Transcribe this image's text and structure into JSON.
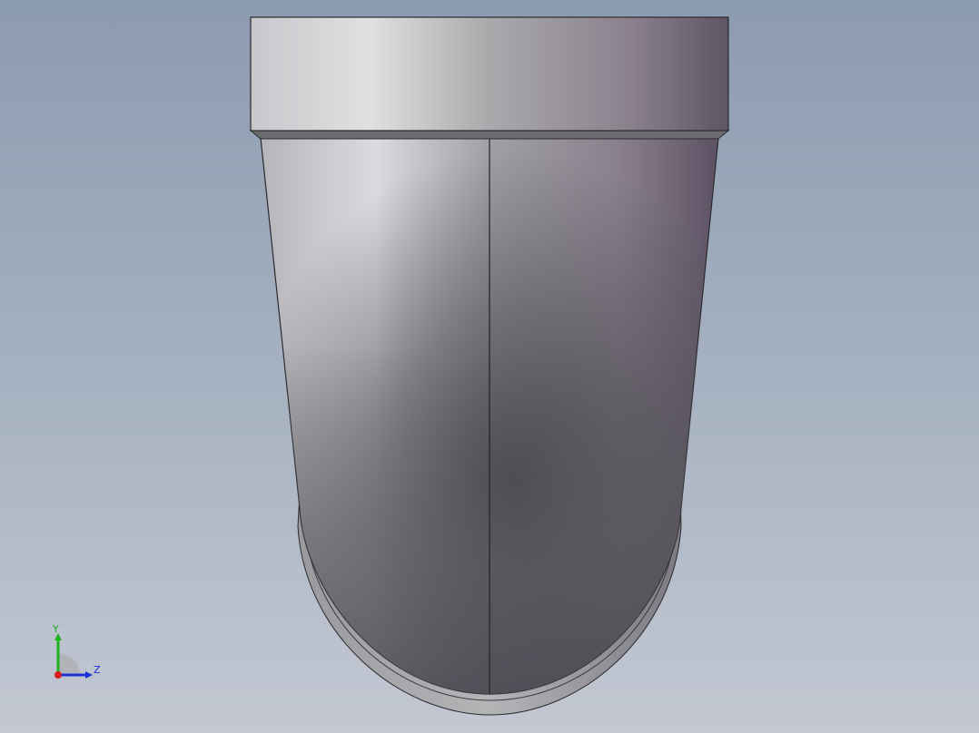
{
  "viewport": {
    "background_top": "#8c9bb0",
    "background_bottom": "#c3c8d2"
  },
  "model": {
    "name": "pipe-elbow",
    "colors": {
      "face_light": "#d9d9dd",
      "face_mid": "#8a8790",
      "face_dark": "#4a4a50",
      "face_purple": "#5f5465",
      "edge": "#2a2a2e"
    }
  },
  "triad": {
    "y_label": "Y",
    "z_label": "Z",
    "colors": {
      "y_axis": "#1fb01f",
      "z_axis": "#1c2fd8",
      "x_axis": "#d81c1c"
    }
  }
}
